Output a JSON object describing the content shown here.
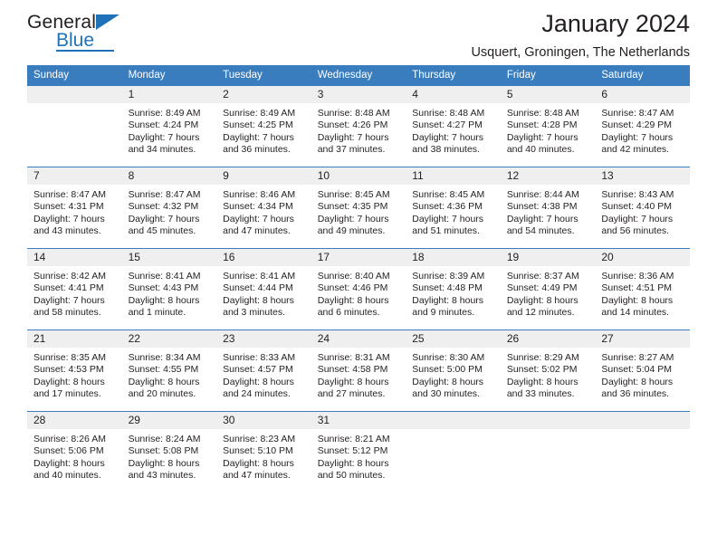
{
  "brand": {
    "line1": "General",
    "line2": "Blue",
    "mark": "triangle-mark",
    "accent_color": "#1f72b8"
  },
  "header": {
    "title": "January 2024",
    "subtitle": "Usquert, Groningen, The Netherlands"
  },
  "theme": {
    "header_bg": "#3a7dbf",
    "daynum_bg": "#efefef",
    "text": "#231f20"
  },
  "weekdays": [
    "Sunday",
    "Monday",
    "Tuesday",
    "Wednesday",
    "Thursday",
    "Friday",
    "Saturday"
  ],
  "weeks": [
    [
      {
        "day": "",
        "sunrise": "",
        "sunset": "",
        "daylight1": "",
        "daylight2": ""
      },
      {
        "day": "1",
        "sunrise": "Sunrise: 8:49 AM",
        "sunset": "Sunset: 4:24 PM",
        "daylight1": "Daylight: 7 hours",
        "daylight2": "and 34 minutes."
      },
      {
        "day": "2",
        "sunrise": "Sunrise: 8:49 AM",
        "sunset": "Sunset: 4:25 PM",
        "daylight1": "Daylight: 7 hours",
        "daylight2": "and 36 minutes."
      },
      {
        "day": "3",
        "sunrise": "Sunrise: 8:48 AM",
        "sunset": "Sunset: 4:26 PM",
        "daylight1": "Daylight: 7 hours",
        "daylight2": "and 37 minutes."
      },
      {
        "day": "4",
        "sunrise": "Sunrise: 8:48 AM",
        "sunset": "Sunset: 4:27 PM",
        "daylight1": "Daylight: 7 hours",
        "daylight2": "and 38 minutes."
      },
      {
        "day": "5",
        "sunrise": "Sunrise: 8:48 AM",
        "sunset": "Sunset: 4:28 PM",
        "daylight1": "Daylight: 7 hours",
        "daylight2": "and 40 minutes."
      },
      {
        "day": "6",
        "sunrise": "Sunrise: 8:47 AM",
        "sunset": "Sunset: 4:29 PM",
        "daylight1": "Daylight: 7 hours",
        "daylight2": "and 42 minutes."
      }
    ],
    [
      {
        "day": "7",
        "sunrise": "Sunrise: 8:47 AM",
        "sunset": "Sunset: 4:31 PM",
        "daylight1": "Daylight: 7 hours",
        "daylight2": "and 43 minutes."
      },
      {
        "day": "8",
        "sunrise": "Sunrise: 8:47 AM",
        "sunset": "Sunset: 4:32 PM",
        "daylight1": "Daylight: 7 hours",
        "daylight2": "and 45 minutes."
      },
      {
        "day": "9",
        "sunrise": "Sunrise: 8:46 AM",
        "sunset": "Sunset: 4:34 PM",
        "daylight1": "Daylight: 7 hours",
        "daylight2": "and 47 minutes."
      },
      {
        "day": "10",
        "sunrise": "Sunrise: 8:45 AM",
        "sunset": "Sunset: 4:35 PM",
        "daylight1": "Daylight: 7 hours",
        "daylight2": "and 49 minutes."
      },
      {
        "day": "11",
        "sunrise": "Sunrise: 8:45 AM",
        "sunset": "Sunset: 4:36 PM",
        "daylight1": "Daylight: 7 hours",
        "daylight2": "and 51 minutes."
      },
      {
        "day": "12",
        "sunrise": "Sunrise: 8:44 AM",
        "sunset": "Sunset: 4:38 PM",
        "daylight1": "Daylight: 7 hours",
        "daylight2": "and 54 minutes."
      },
      {
        "day": "13",
        "sunrise": "Sunrise: 8:43 AM",
        "sunset": "Sunset: 4:40 PM",
        "daylight1": "Daylight: 7 hours",
        "daylight2": "and 56 minutes."
      }
    ],
    [
      {
        "day": "14",
        "sunrise": "Sunrise: 8:42 AM",
        "sunset": "Sunset: 4:41 PM",
        "daylight1": "Daylight: 7 hours",
        "daylight2": "and 58 minutes."
      },
      {
        "day": "15",
        "sunrise": "Sunrise: 8:41 AM",
        "sunset": "Sunset: 4:43 PM",
        "daylight1": "Daylight: 8 hours",
        "daylight2": "and 1 minute."
      },
      {
        "day": "16",
        "sunrise": "Sunrise: 8:41 AM",
        "sunset": "Sunset: 4:44 PM",
        "daylight1": "Daylight: 8 hours",
        "daylight2": "and 3 minutes."
      },
      {
        "day": "17",
        "sunrise": "Sunrise: 8:40 AM",
        "sunset": "Sunset: 4:46 PM",
        "daylight1": "Daylight: 8 hours",
        "daylight2": "and 6 minutes."
      },
      {
        "day": "18",
        "sunrise": "Sunrise: 8:39 AM",
        "sunset": "Sunset: 4:48 PM",
        "daylight1": "Daylight: 8 hours",
        "daylight2": "and 9 minutes."
      },
      {
        "day": "19",
        "sunrise": "Sunrise: 8:37 AM",
        "sunset": "Sunset: 4:49 PM",
        "daylight1": "Daylight: 8 hours",
        "daylight2": "and 12 minutes."
      },
      {
        "day": "20",
        "sunrise": "Sunrise: 8:36 AM",
        "sunset": "Sunset: 4:51 PM",
        "daylight1": "Daylight: 8 hours",
        "daylight2": "and 14 minutes."
      }
    ],
    [
      {
        "day": "21",
        "sunrise": "Sunrise: 8:35 AM",
        "sunset": "Sunset: 4:53 PM",
        "daylight1": "Daylight: 8 hours",
        "daylight2": "and 17 minutes."
      },
      {
        "day": "22",
        "sunrise": "Sunrise: 8:34 AM",
        "sunset": "Sunset: 4:55 PM",
        "daylight1": "Daylight: 8 hours",
        "daylight2": "and 20 minutes."
      },
      {
        "day": "23",
        "sunrise": "Sunrise: 8:33 AM",
        "sunset": "Sunset: 4:57 PM",
        "daylight1": "Daylight: 8 hours",
        "daylight2": "and 24 minutes."
      },
      {
        "day": "24",
        "sunrise": "Sunrise: 8:31 AM",
        "sunset": "Sunset: 4:58 PM",
        "daylight1": "Daylight: 8 hours",
        "daylight2": "and 27 minutes."
      },
      {
        "day": "25",
        "sunrise": "Sunrise: 8:30 AM",
        "sunset": "Sunset: 5:00 PM",
        "daylight1": "Daylight: 8 hours",
        "daylight2": "and 30 minutes."
      },
      {
        "day": "26",
        "sunrise": "Sunrise: 8:29 AM",
        "sunset": "Sunset: 5:02 PM",
        "daylight1": "Daylight: 8 hours",
        "daylight2": "and 33 minutes."
      },
      {
        "day": "27",
        "sunrise": "Sunrise: 8:27 AM",
        "sunset": "Sunset: 5:04 PM",
        "daylight1": "Daylight: 8 hours",
        "daylight2": "and 36 minutes."
      }
    ],
    [
      {
        "day": "28",
        "sunrise": "Sunrise: 8:26 AM",
        "sunset": "Sunset: 5:06 PM",
        "daylight1": "Daylight: 8 hours",
        "daylight2": "and 40 minutes."
      },
      {
        "day": "29",
        "sunrise": "Sunrise: 8:24 AM",
        "sunset": "Sunset: 5:08 PM",
        "daylight1": "Daylight: 8 hours",
        "daylight2": "and 43 minutes."
      },
      {
        "day": "30",
        "sunrise": "Sunrise: 8:23 AM",
        "sunset": "Sunset: 5:10 PM",
        "daylight1": "Daylight: 8 hours",
        "daylight2": "and 47 minutes."
      },
      {
        "day": "31",
        "sunrise": "Sunrise: 8:21 AM",
        "sunset": "Sunset: 5:12 PM",
        "daylight1": "Daylight: 8 hours",
        "daylight2": "and 50 minutes."
      },
      {
        "day": "",
        "sunrise": "",
        "sunset": "",
        "daylight1": "",
        "daylight2": ""
      },
      {
        "day": "",
        "sunrise": "",
        "sunset": "",
        "daylight1": "",
        "daylight2": ""
      },
      {
        "day": "",
        "sunrise": "",
        "sunset": "",
        "daylight1": "",
        "daylight2": ""
      }
    ]
  ]
}
